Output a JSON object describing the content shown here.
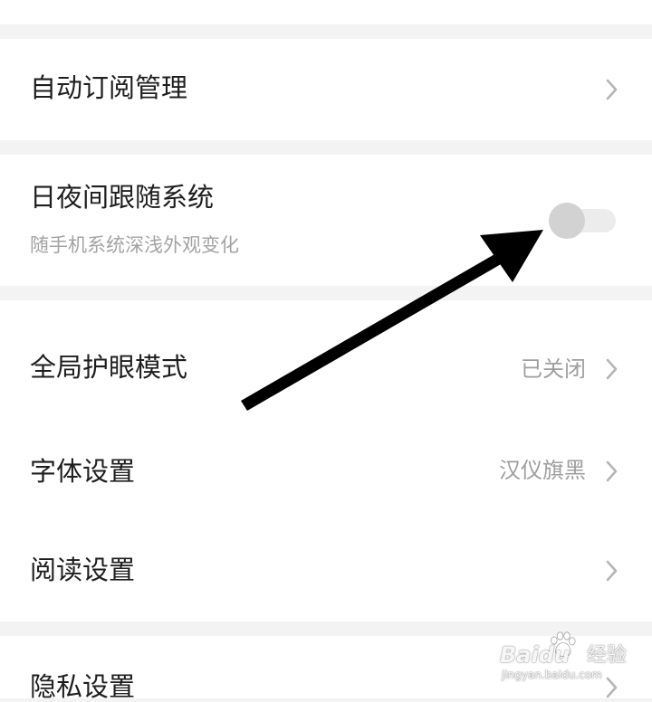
{
  "settings": {
    "auto_subscribe": {
      "label": "自动订阅管理"
    },
    "day_night": {
      "label": "日夜间跟随系统",
      "sublabel": "随手机系统深浅外观变化",
      "toggle_on": false
    },
    "eye_protection": {
      "label": "全局护眼模式",
      "value": "已关闭"
    },
    "font": {
      "label": "字体设置",
      "value": "汉仪旗黑"
    },
    "reading": {
      "label": "阅读设置"
    },
    "privacy": {
      "label": "隐私设置"
    }
  },
  "watermark": {
    "brand": "Baidu",
    "suffix": "经验",
    "url": "jingyan.baidu.com"
  },
  "colors": {
    "background": "#f3f3f3",
    "card": "#ffffff",
    "text": "#1e1e1e",
    "secondary_text": "#9e9e9e",
    "arrow": "#000000"
  },
  "icons": {
    "row_chevron": "chevron-right-icon",
    "annotation": "arrow-annotation"
  }
}
